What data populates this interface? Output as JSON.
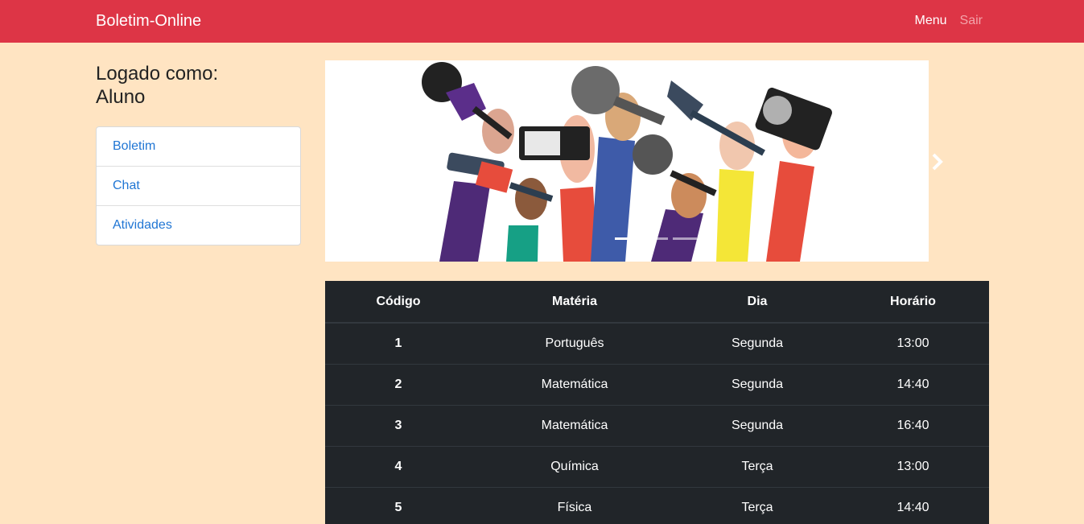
{
  "navbar": {
    "brand": "Boletim-Online",
    "links": [
      "Menu",
      "Sair"
    ],
    "color": "#dd3546"
  },
  "sidebar": {
    "logged_label": "Logado como:",
    "user_role": "Aluno",
    "items": [
      {
        "label": "Boletim"
      },
      {
        "label": "Chat"
      },
      {
        "label": "Atividades"
      }
    ]
  },
  "carousel": {
    "image": "hands-holding-microphones-illustration",
    "next_icon": "chevron-right-icon",
    "slides_count": 3,
    "active_index": 0
  },
  "schedule": {
    "headers": [
      "Código",
      "Matéria",
      "Dia",
      "Horário"
    ],
    "rows": [
      {
        "codigo": "1",
        "materia": "Português",
        "dia": "Segunda",
        "horario": "13:00"
      },
      {
        "codigo": "2",
        "materia": "Matemática",
        "dia": "Segunda",
        "horario": "14:40"
      },
      {
        "codigo": "3",
        "materia": "Matemática",
        "dia": "Segunda",
        "horario": "16:40"
      },
      {
        "codigo": "4",
        "materia": "Química",
        "dia": "Terça",
        "horario": "13:00"
      },
      {
        "codigo": "5",
        "materia": "Física",
        "dia": "Terça",
        "horario": "14:40"
      }
    ]
  },
  "colors": {
    "page_bg": "#ffe4c2",
    "table_bg": "#212529",
    "link": "#2076d4"
  }
}
